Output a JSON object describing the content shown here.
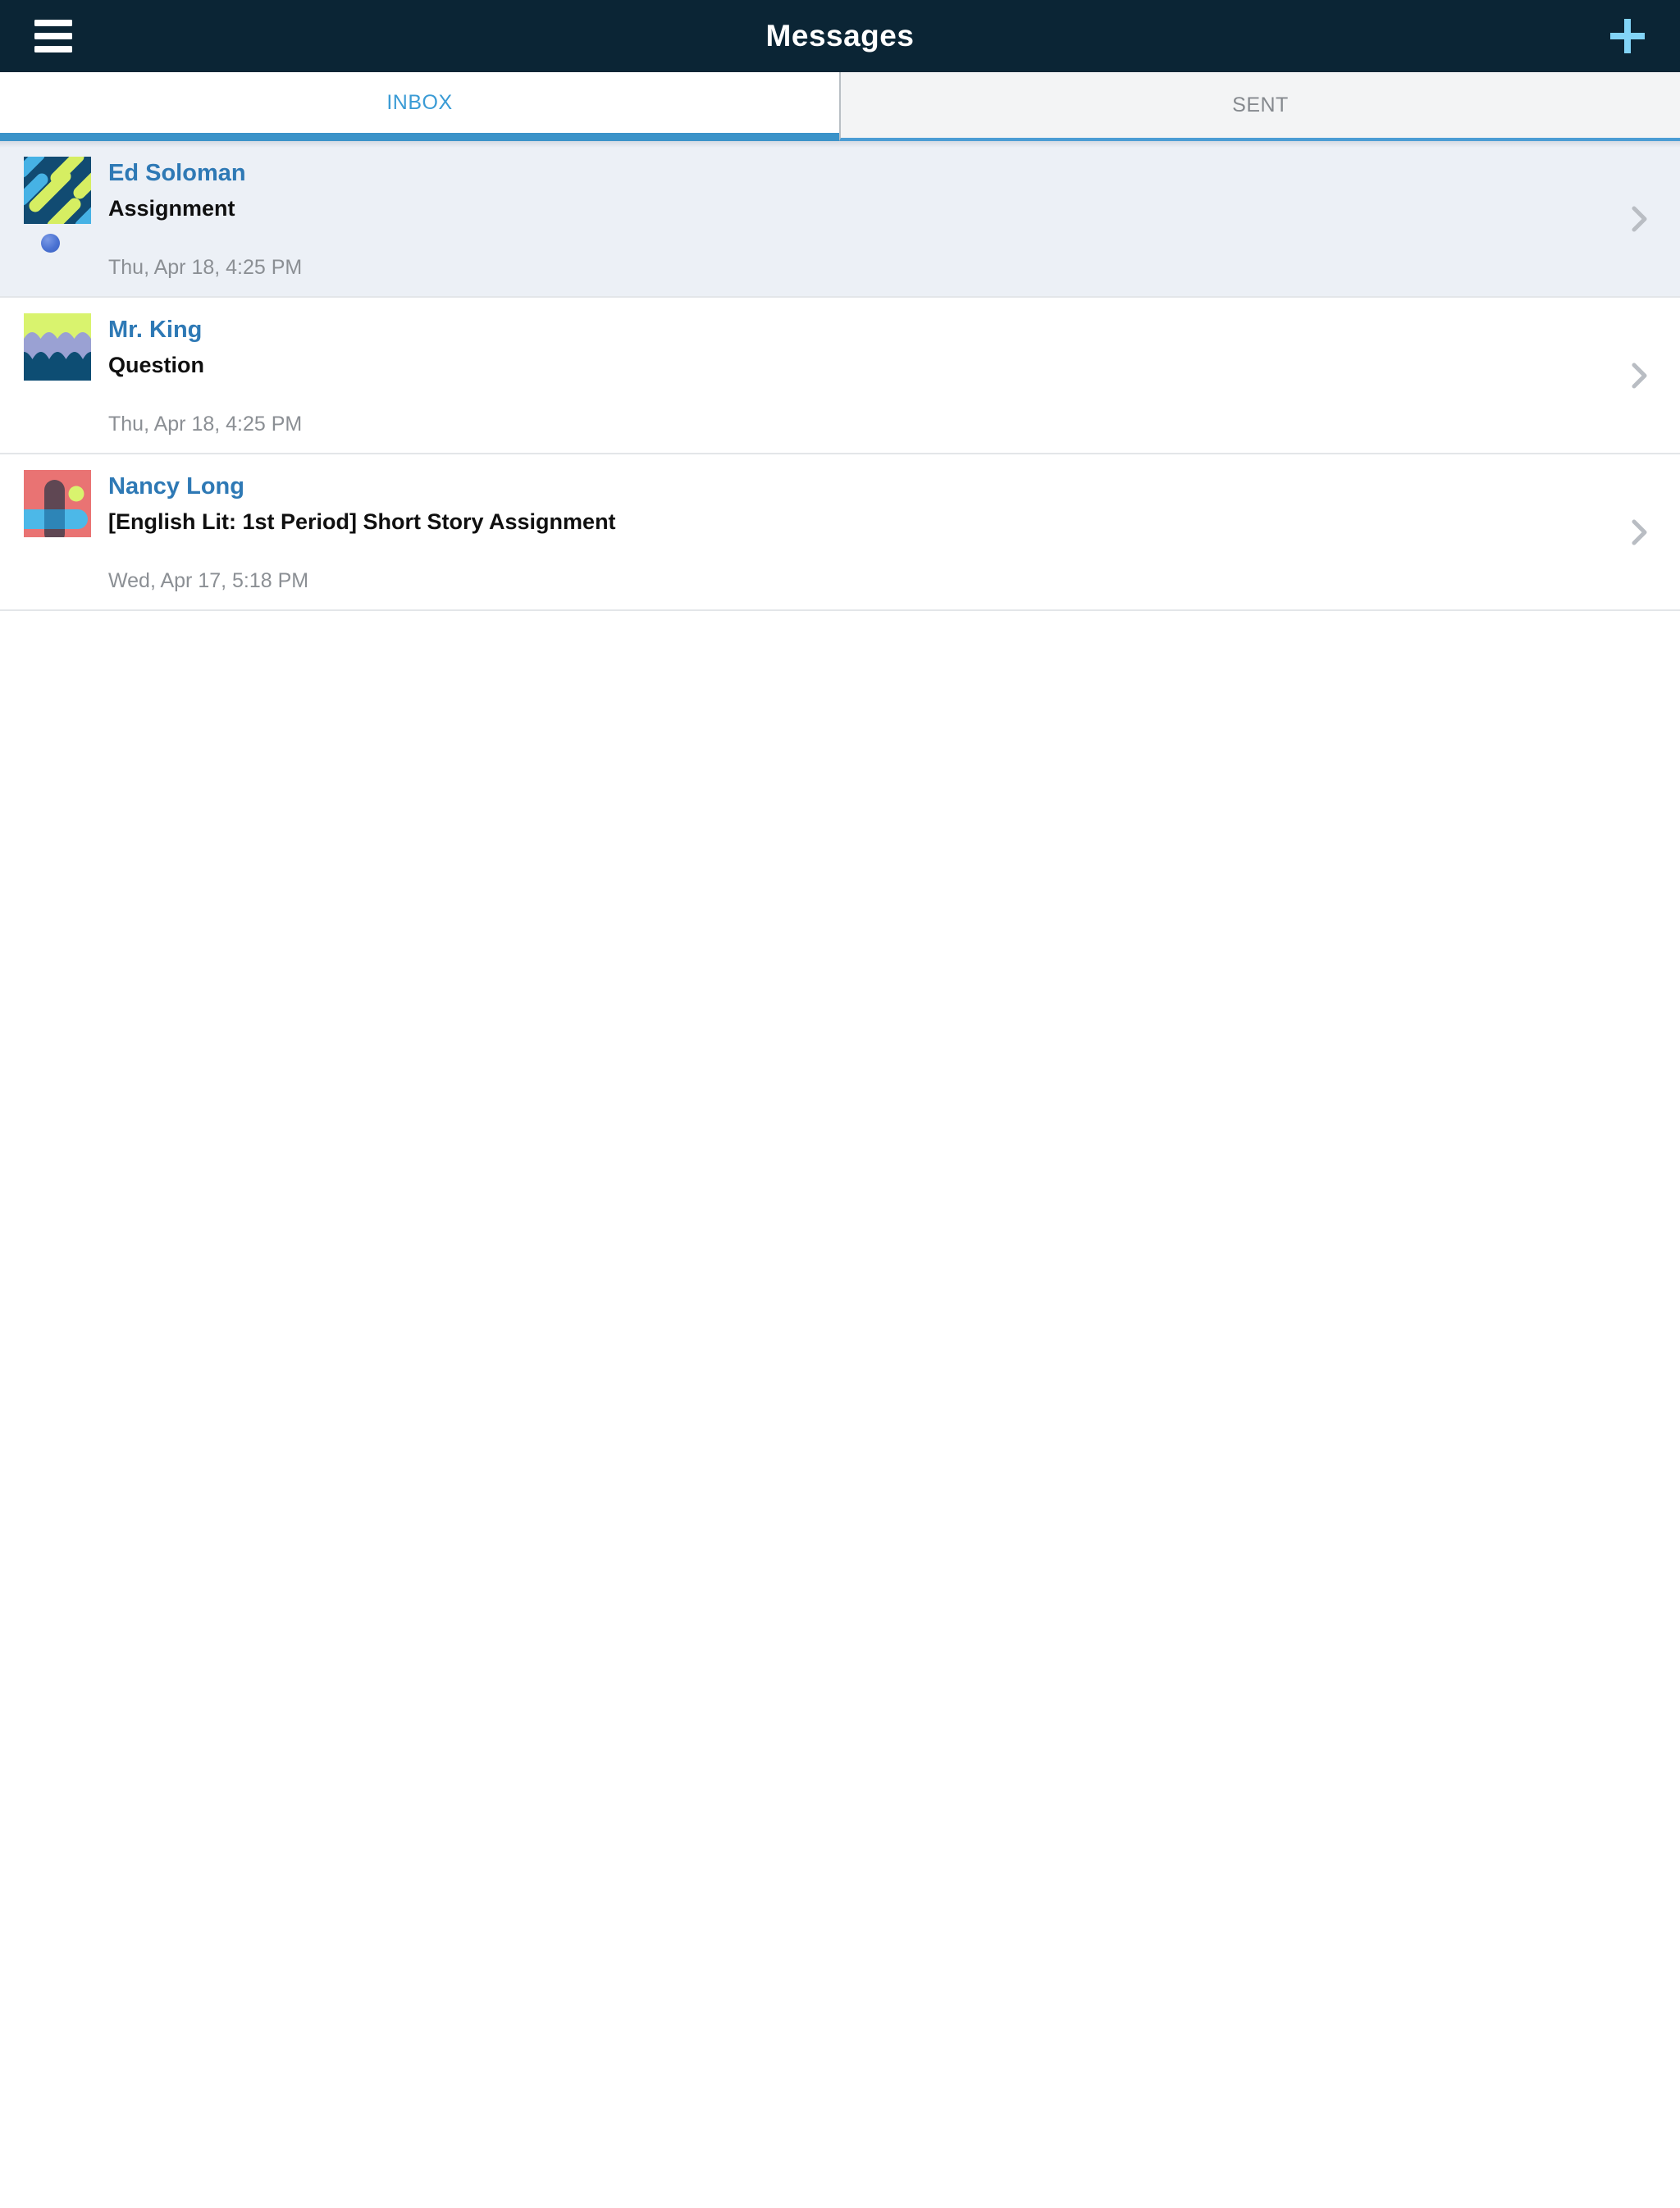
{
  "header": {
    "title": "Messages"
  },
  "tabs": {
    "inbox": "INBOX",
    "sent": "SENT"
  },
  "messages": [
    {
      "sender": "Ed Soloman",
      "subject": "Assignment",
      "timestamp": "Thu, Apr 18, 4:25 PM",
      "unread": true,
      "avatar": "diagonal-stripes"
    },
    {
      "sender": "Mr. King",
      "subject": "Question",
      "timestamp": "Thu, Apr 18, 4:25 PM",
      "unread": false,
      "avatar": "waves"
    },
    {
      "sender": "Nancy Long",
      "subject": "[English Lit: 1st Period] Short Story Assignment",
      "timestamp": "Wed, Apr 17, 5:18 PM",
      "unread": false,
      "avatar": "abstract-shapes"
    }
  ],
  "icons": {
    "menu": "hamburger-icon",
    "compose": "plus-icon",
    "row_indicator": "chevron-right-icon",
    "unread_marker": "unread-dot"
  },
  "colors": {
    "header_bg": "#0b2535",
    "tab_accent": "#3b93c9",
    "plus_icon": "#82d4f7",
    "inbox_tab_text": "#3a9bd5",
    "sent_tab_text": "#85898e",
    "sent_tab_bg": "#f3f4f5",
    "sender_name": "#2e79b5",
    "subject_text": "#101010",
    "timestamp_text": "#8b8f94",
    "unread_dot": "#4a72d2",
    "unread_row_bg": "#ecf0f6",
    "chevron": "#b9bdc3"
  }
}
